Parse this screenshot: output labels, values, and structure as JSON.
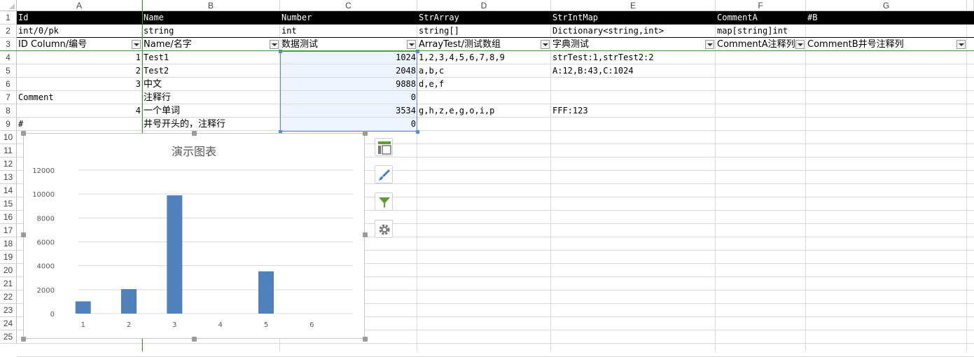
{
  "columns": [
    "A",
    "B",
    "C",
    "D",
    "E",
    "F",
    "G"
  ],
  "rows": [
    "1",
    "2",
    "3",
    "4",
    "5",
    "6",
    "7",
    "8",
    "9",
    "10",
    "11",
    "12",
    "13",
    "14",
    "15",
    "16",
    "17",
    "18",
    "19",
    "20",
    "21",
    "22",
    "23",
    "24",
    "25"
  ],
  "header_row": {
    "a": "Id",
    "b": "Name",
    "c": "Number",
    "d": "StrArray",
    "e": "StrIntMap",
    "f": "CommentA",
    "g": "#B"
  },
  "type_row": {
    "a": "int/0/pk",
    "b": "string",
    "c": "int",
    "d": "string[]",
    "e": "Dictionary<string,int>",
    "f": "map[string]int"
  },
  "desc_row": {
    "a": "ID Column/编号",
    "b": "Name/名字",
    "c": "数据测试",
    "d": "ArrayTest/测试数组",
    "e": "字典测试",
    "f": "CommentA注释列",
    "g": "CommentB井号注释列"
  },
  "data_rows": [
    {
      "a": "1",
      "b": "Test1",
      "c": "1024",
      "d": "1,2,3,4,5,6,7,8,9",
      "e": "strTest:1,strTest2:2"
    },
    {
      "a": "2",
      "b": "Test2",
      "c": "2048",
      "d": "a,b,c",
      "e": "A:12,B:43,C:1024"
    },
    {
      "a": "3",
      "b": "中文",
      "c": "9888",
      "d": "d,e,f",
      "e": ""
    },
    {
      "a": "Comment",
      "b": "注释行",
      "c": "0",
      "d": "",
      "e": ""
    },
    {
      "a": "4",
      "b": "一个单词",
      "c": "3534",
      "d": "g,h,z,e,g,o,i,p",
      "e": "FFF:123"
    },
    {
      "a": "#",
      "b": "井号开头的，注释行",
      "c": "0",
      "d": "",
      "e": ""
    }
  ],
  "chart_data": {
    "type": "bar",
    "title": "演示图表",
    "categories": [
      "1",
      "2",
      "3",
      "4",
      "5",
      "6"
    ],
    "values": [
      1024,
      2048,
      9888,
      0,
      3534,
      0
    ],
    "yticks": [
      "0",
      "2000",
      "4000",
      "6000",
      "8000",
      "10000",
      "12000"
    ],
    "ylim": [
      0,
      12000
    ],
    "grid": true,
    "bar_color": "#4f81bd"
  },
  "chart_tools": [
    "chart-elements-icon",
    "chart-styles-icon",
    "chart-filters-icon",
    "chart-settings-icon"
  ],
  "colors": {
    "header_bg": "#000000",
    "selection": "#5b8bd5",
    "freeze_line": "#3a9a3a"
  }
}
